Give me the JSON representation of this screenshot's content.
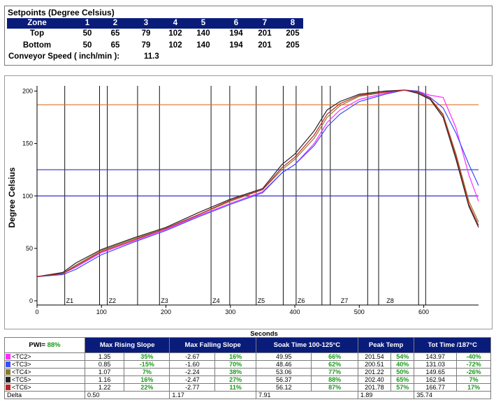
{
  "setpoints": {
    "title": "Setpoints (Degree Celsius)",
    "zone_label": "Zone",
    "zones": [
      "1",
      "2",
      "3",
      "4",
      "5",
      "6",
      "7",
      "8"
    ],
    "top_label": "Top",
    "top": [
      "50",
      "65",
      "79",
      "102",
      "140",
      "194",
      "201",
      "205"
    ],
    "bottom_label": "Bottom",
    "bottom": [
      "50",
      "65",
      "79",
      "102",
      "140",
      "194",
      "201",
      "205"
    ],
    "conveyor_label": "Conveyor Speed ( inch/min ):",
    "conveyor_value": "11.3"
  },
  "chart_data": {
    "type": "line",
    "title": "",
    "xlabel": "Seconds",
    "ylabel": "Degree Celsius",
    "xlim": [
      0,
      685
    ],
    "ylim": [
      -4,
      205
    ],
    "xticks": [
      0,
      100,
      200,
      300,
      400,
      500,
      600
    ],
    "yticks": [
      0,
      50,
      100,
      150,
      200
    ],
    "zone_lines": [
      0,
      43,
      97,
      109,
      156,
      190,
      270,
      299,
      340,
      382,
      402,
      442,
      455,
      513,
      530,
      592,
      603
    ],
    "zone_labels": [
      {
        "label": "Z1",
        "x": 43
      },
      {
        "label": "Z2",
        "x": 109
      },
      {
        "label": "Z3",
        "x": 190
      },
      {
        "label": "Z4",
        "x": 270
      },
      {
        "label": "Z5",
        "x": 340
      },
      {
        "label": "Z6",
        "x": 402
      },
      {
        "label": "Z7",
        "x": 469
      },
      {
        "label": "Z8",
        "x": 540
      }
    ],
    "hlines": [
      {
        "y": 187,
        "color": "#e07020"
      },
      {
        "y": 125,
        "color": "#3030d0"
      },
      {
        "y": 100,
        "color": "#3030d0"
      }
    ],
    "series": [
      {
        "color": "#ff2dff",
        "x": [
          0,
          40,
          60,
          100,
          150,
          200,
          250,
          300,
          350,
          380,
          400,
          430,
          450,
          470,
          500,
          540,
          570,
          590,
          610,
          630,
          650,
          670,
          685
        ],
        "y": [
          23,
          26,
          32,
          46,
          57,
          68,
          81,
          93,
          104,
          122,
          130,
          150,
          170,
          182,
          192,
          198,
          201,
          200,
          196,
          194,
          165,
          120,
          95
        ]
      },
      {
        "color": "#3a4cff",
        "x": [
          0,
          40,
          60,
          100,
          150,
          200,
          250,
          300,
          350,
          380,
          400,
          430,
          450,
          470,
          500,
          540,
          570,
          590,
          610,
          630,
          650,
          670,
          685
        ],
        "y": [
          23,
          25,
          30,
          44,
          56,
          67,
          80,
          92,
          103,
          122,
          130,
          148,
          166,
          178,
          190,
          197,
          201,
          200,
          194,
          184,
          160,
          130,
          110
        ]
      },
      {
        "color": "#8a7a2e",
        "x": [
          0,
          40,
          60,
          100,
          150,
          200,
          250,
          300,
          350,
          380,
          400,
          430,
          450,
          470,
          500,
          540,
          570,
          590,
          610,
          630,
          650,
          670,
          685
        ],
        "y": [
          23,
          26,
          34,
          48,
          59,
          69,
          82,
          95,
          106,
          125,
          135,
          155,
          175,
          186,
          195,
          199,
          201,
          199,
          193,
          178,
          140,
          95,
          75
        ]
      },
      {
        "color": "#222222",
        "x": [
          0,
          40,
          60,
          100,
          150,
          200,
          250,
          300,
          350,
          380,
          400,
          430,
          450,
          470,
          500,
          540,
          570,
          590,
          610,
          630,
          650,
          670,
          685
        ],
        "y": [
          23,
          27,
          36,
          49,
          60,
          70,
          84,
          97,
          107,
          130,
          140,
          162,
          182,
          190,
          197,
          200,
          201,
          198,
          192,
          175,
          135,
          90,
          70
        ]
      },
      {
        "color": "#c02020",
        "x": [
          0,
          40,
          60,
          100,
          150,
          200,
          250,
          300,
          350,
          380,
          400,
          430,
          450,
          470,
          500,
          540,
          570,
          590,
          610,
          630,
          650,
          670,
          685
        ],
        "y": [
          23,
          26,
          33,
          47,
          58,
          69,
          82,
          96,
          106,
          127,
          137,
          158,
          178,
          188,
          196,
          199,
          201,
          199,
          193,
          177,
          138,
          92,
          72
        ]
      }
    ]
  },
  "stats": {
    "pwi_label": "PWI=",
    "pwi_value": "88%",
    "headers": [
      "Max Rising Slope",
      "Max Falling Slope",
      "Soak Time 100-125°C",
      "Peak Temp",
      "Tot Time /187°C"
    ],
    "rows": [
      {
        "tc": "<TC2>",
        "color": "#ff2dff",
        "values": [
          "1.35",
          "35%",
          "-2.67",
          "16%",
          "49.95",
          "66%",
          "201.54",
          "54%",
          "143.97",
          "-40%"
        ]
      },
      {
        "tc": "<TC3>",
        "color": "#3a4cff",
        "values": [
          "0.85",
          "-15%",
          "-1.60",
          "70%",
          "48.46",
          "62%",
          "200.51",
          "40%",
          "131.03",
          "-72%"
        ]
      },
      {
        "tc": "<TC4>",
        "color": "#8a7a2e",
        "values": [
          "1.07",
          "7%",
          "-2.24",
          "38%",
          "53.06",
          "77%",
          "201.22",
          "50%",
          "149.65",
          "-26%"
        ]
      },
      {
        "tc": "<TC5>",
        "color": "#222222",
        "values": [
          "1.16",
          "16%",
          "-2.47",
          "27%",
          "56.37",
          "88%",
          "202.40",
          "65%",
          "162.94",
          "7%"
        ]
      },
      {
        "tc": "<TC6>",
        "color": "#c02020",
        "values": [
          "1.22",
          "22%",
          "-2.77",
          "11%",
          "56.12",
          "87%",
          "201.78",
          "57%",
          "166.77",
          "17%"
        ]
      }
    ],
    "delta_label": "Delta",
    "delta": [
      "0.50",
      "1.17",
      "7.91",
      "1.89",
      "35.74"
    ]
  }
}
